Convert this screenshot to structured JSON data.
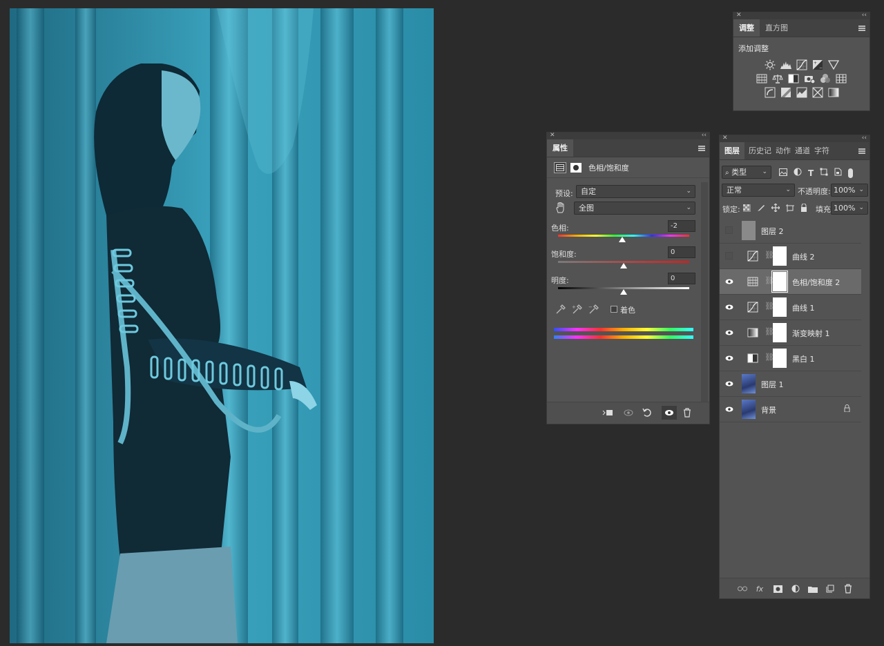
{
  "adjustments_panel": {
    "tabs": [
      "调整",
      "直方图"
    ],
    "title": "添加调整",
    "row1": [
      "brightness-icon",
      "levels-icon",
      "curves-icon",
      "exposure-icon",
      "vibrance-icon"
    ],
    "row2": [
      "hue-saturation-icon",
      "color-balance-icon",
      "black-white-icon",
      "photo-filter-icon",
      "channel-mixer-icon",
      "color-lookup-icon"
    ],
    "row3": [
      "invert-icon",
      "posterize-icon",
      "threshold-icon",
      "selective-color-icon",
      "gradient-map-icon"
    ]
  },
  "properties_panel": {
    "tab": "属性",
    "adjustment_name": "色相/饱和度",
    "preset_label": "预设:",
    "preset_value": "自定",
    "range_value": "全图",
    "hue_label": "色相:",
    "hue_value": "-2",
    "saturation_label": "饱和度:",
    "saturation_value": "0",
    "lightness_label": "明度:",
    "lightness_value": "0",
    "colorize_label": "着色",
    "colorize_checked": false,
    "hue_fraction": 0.49,
    "saturation_fraction": 0.5,
    "lightness_fraction": 0.5
  },
  "layers_panel": {
    "tabs": [
      "图层",
      "历史记",
      "动作",
      "通道",
      "字符"
    ],
    "filter_label": "类型",
    "blend_mode": "正常",
    "opacity_label": "不透明度:",
    "opacity_value": "100%",
    "lock_label": "锁定:",
    "fill_label": "填充:",
    "fill_value": "100%",
    "layers": [
      {
        "name": "图层 2",
        "visible": false,
        "kind": "gray"
      },
      {
        "name": "曲线 2",
        "visible": false,
        "kind": "curves"
      },
      {
        "name": "色相/饱和度 2",
        "visible": true,
        "kind": "hue",
        "selected": true
      },
      {
        "name": "曲线 1",
        "visible": true,
        "kind": "curves"
      },
      {
        "name": "渐变映射 1",
        "visible": true,
        "kind": "gradient"
      },
      {
        "name": "黑白 1",
        "visible": true,
        "kind": "bw"
      },
      {
        "name": "图层 1",
        "visible": true,
        "kind": "photo"
      },
      {
        "name": "背景",
        "visible": true,
        "kind": "photo",
        "locked": true
      }
    ]
  },
  "colors": {
    "panel_bg": "#535353",
    "app_bg": "#2b2b2b",
    "canvas_tint": "#2e8aa3"
  }
}
